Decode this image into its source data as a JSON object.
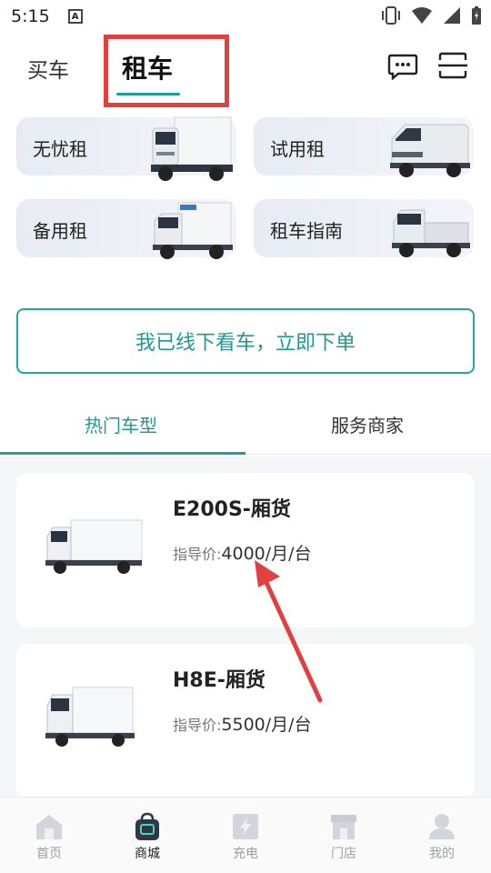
{
  "status_bar": {
    "time": "5:15",
    "notif_icon": "a-notification-icon"
  },
  "header": {
    "tab_buy": "买车",
    "tab_rent": "租车",
    "message_icon": "chat-bubble-icon",
    "scan_icon": "scan-icon",
    "accent": "#1aa09a",
    "highlight": "#e04040"
  },
  "services": [
    {
      "label": "无忧租"
    },
    {
      "label": "试用租"
    },
    {
      "label": "备用租"
    },
    {
      "label": "租车指南"
    }
  ],
  "order_button": {
    "label": "我已线下看车，立即下单"
  },
  "segment_tabs": {
    "hot": "热门车型",
    "merchant": "服务商家"
  },
  "products": [
    {
      "name": "E200S-厢货",
      "price_label": "指导价:",
      "price": "4000/月/台"
    },
    {
      "name": "H8E-厢货",
      "price_label": "指导价:",
      "price": "5500/月/台"
    }
  ],
  "bottom_nav": [
    {
      "label": "首页",
      "icon": "home-icon"
    },
    {
      "label": "商城",
      "icon": "shop-bag-icon"
    },
    {
      "label": "充电",
      "icon": "charge-icon"
    },
    {
      "label": "门店",
      "icon": "store-icon"
    },
    {
      "label": "我的",
      "icon": "profile-icon"
    }
  ]
}
